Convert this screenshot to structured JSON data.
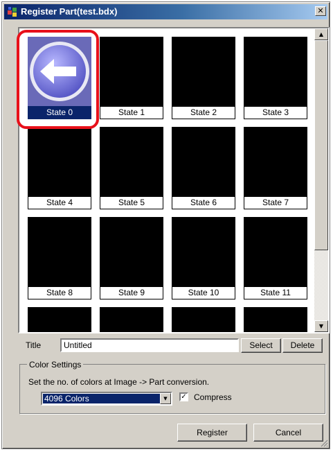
{
  "window": {
    "title": "Register Part(test.bdx)",
    "close_glyph": "✕"
  },
  "parts_grid": {
    "states": [
      {
        "label": "State 0",
        "has_image": true,
        "icon": "left-arrow-circle-icon"
      },
      {
        "label": "State 1",
        "has_image": false
      },
      {
        "label": "State 2",
        "has_image": false
      },
      {
        "label": "State 3",
        "has_image": false
      },
      {
        "label": "State 4",
        "has_image": false
      },
      {
        "label": "State 5",
        "has_image": false
      },
      {
        "label": "State 6",
        "has_image": false
      },
      {
        "label": "State 7",
        "has_image": false
      },
      {
        "label": "State 8",
        "has_image": false
      },
      {
        "label": "State 9",
        "has_image": false
      },
      {
        "label": "State 10",
        "has_image": false
      },
      {
        "label": "State 11",
        "has_image": false
      },
      {
        "label": "",
        "has_image": false
      },
      {
        "label": "",
        "has_image": false
      },
      {
        "label": "",
        "has_image": false
      },
      {
        "label": "",
        "has_image": false
      }
    ],
    "selected_index": 0,
    "highlight_color": "#e8101a",
    "selection_color": "#0a246a"
  },
  "scrollbar": {
    "up_glyph": "▲",
    "down_glyph": "▼"
  },
  "title_field": {
    "label": "Title",
    "value": "Untitled"
  },
  "buttons": {
    "select": "Select",
    "delete": "Delete",
    "register": "Register",
    "cancel": "Cancel"
  },
  "color_settings": {
    "legend": "Color Settings",
    "description": "Set the no. of colors at Image -> Part conversion.",
    "selected_colors": "4096 Colors",
    "dropdown_glyph": "▼",
    "compress_label": "Compress",
    "compress_checked": true,
    "check_glyph": "✓"
  },
  "colors": {
    "titlebar_start": "#0a246a",
    "dialog_face": "#d4d0c8"
  }
}
